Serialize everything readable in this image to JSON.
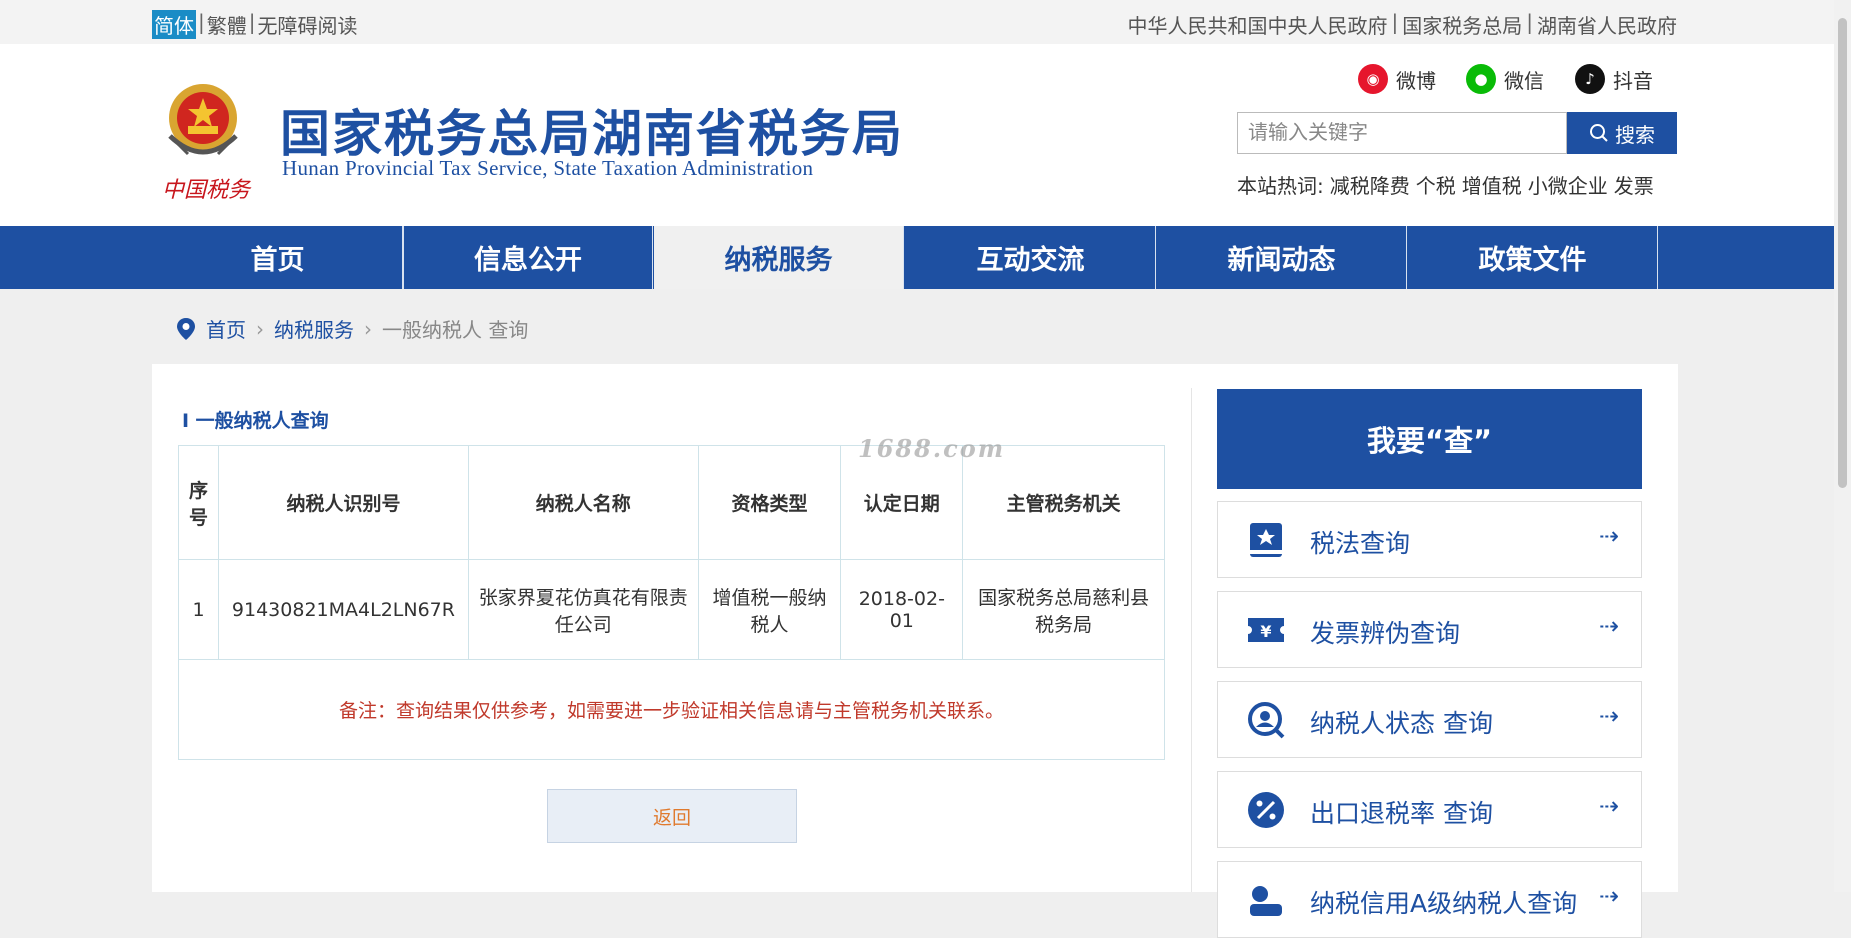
{
  "topbar": {
    "lang_simplified": "简体",
    "lang_traditional": "繁體",
    "accessible": "无障碍阅读",
    "links": [
      "中华人民共和国中央人民政府",
      "国家税务总局",
      "湖南省人民政府"
    ]
  },
  "header": {
    "title_cn": "国家税务总局湖南省税务局",
    "title_en": "Hunan Provincial  Tax Service,  State Taxation Administration",
    "seal_text": "中国税务",
    "social": [
      {
        "label": "微博",
        "icon": "weibo-icon",
        "color": "#e6162d"
      },
      {
        "label": "微信",
        "icon": "wechat-icon",
        "color": "#09bb07"
      },
      {
        "label": "抖音",
        "icon": "douyin-icon",
        "color": "#111111"
      }
    ],
    "search_placeholder": "请输入关键字",
    "search_button": "搜索",
    "hot_label": "本站热词:",
    "hot_words": [
      "减税降费",
      "个税",
      "增值税",
      "小微企业",
      "发票"
    ]
  },
  "nav": [
    "首页",
    "信息公开",
    "纳税服务",
    "互动交流",
    "新闻动态",
    "政策文件"
  ],
  "nav_active": "纳税服务",
  "breadcrumb": {
    "home": "首页",
    "level1": "纳税服务",
    "current": "一般纳税人 查询"
  },
  "main": {
    "section_title": "I 一般纳税人查询",
    "table": {
      "headers": [
        "序号",
        "纳税人识别号",
        "纳税人名称",
        "资格类型",
        "认定日期",
        "主管税务机关"
      ],
      "rows": [
        [
          "1",
          "91430821MA4L2LN67R",
          "张家界夏花仿真花有限责任公司",
          "增值税一般纳税人",
          "2018-02-01",
          "国家税务总局慈利县税务局"
        ]
      ],
      "note": "备注：查询结果仅供参考，如需要进一步验证相关信息请与主管税务机关联系。"
    },
    "back_button": "返回"
  },
  "sidebar": {
    "title": "我要“查”",
    "items": [
      {
        "label": "税法查询",
        "icon": "tax-law-book-icon"
      },
      {
        "label": "发票辨伪查询",
        "icon": "invoice-yuan-icon"
      },
      {
        "label": "纳税人状态 查询",
        "icon": "taxpayer-search-icon"
      },
      {
        "label": "出口退税率 查询",
        "icon": "percent-icon"
      },
      {
        "label": "纳税信用A级纳税人查询",
        "icon": "credit-icon"
      }
    ],
    "arrow": "⇢"
  },
  "watermark": "1688.com",
  "colors": {
    "brand_blue": "#1e50a2",
    "note_red": "#c0392b",
    "back_orange": "#e07a2e"
  }
}
